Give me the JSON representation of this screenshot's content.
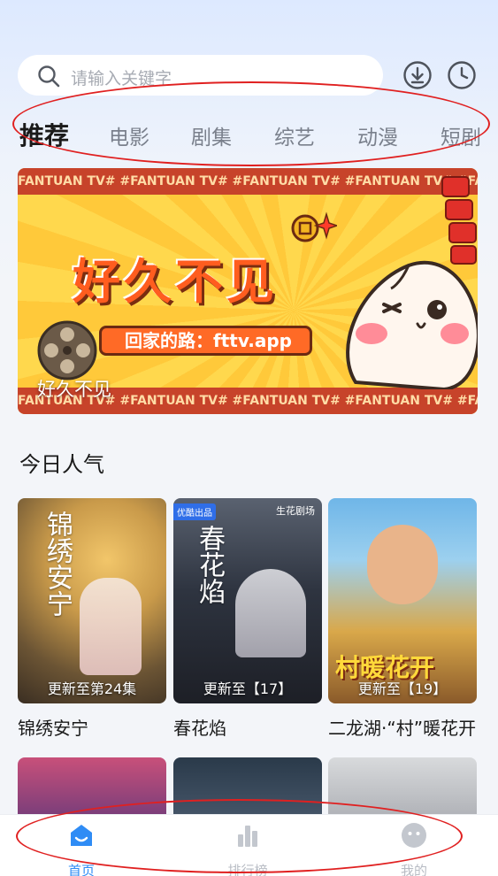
{
  "search": {
    "placeholder": "请输入关键字"
  },
  "tabs": [
    {
      "label": "推荐",
      "active": true
    },
    {
      "label": "电影",
      "active": false
    },
    {
      "label": "剧集",
      "active": false
    },
    {
      "label": "综艺",
      "active": false
    },
    {
      "label": "动漫",
      "active": false
    },
    {
      "label": "短剧",
      "active": false
    }
  ],
  "banner": {
    "strip_text": "FANTUAN TV#   #FANTUAN TV#   #FANTUAN TV#   #FANTUAN TV#   #FANTUAN TV#",
    "headline": "好久不见",
    "url_text": "回家的路：fttv.app",
    "caption": "好久不见"
  },
  "section": {
    "title": "今日人气"
  },
  "cards": [
    {
      "title": "锦绣安宁",
      "badge": "更新至第24集",
      "art_text": "锦绣安宁"
    },
    {
      "title": "春花焰",
      "badge": "更新至【17】",
      "art_text": "春花焰",
      "corner_tag": "优酷出品",
      "studio": "生花剧场"
    },
    {
      "title": "二龙湖·“村”暖花开",
      "badge": "更新至【19】",
      "art_text": "村暖花开"
    }
  ],
  "bottom_nav": [
    {
      "label": "首页",
      "active": true
    },
    {
      "label": "排行榜",
      "active": false
    },
    {
      "label": "我的",
      "active": false
    }
  ],
  "colors": {
    "accent": "#2f8cf5",
    "annotation": "#e02020"
  }
}
